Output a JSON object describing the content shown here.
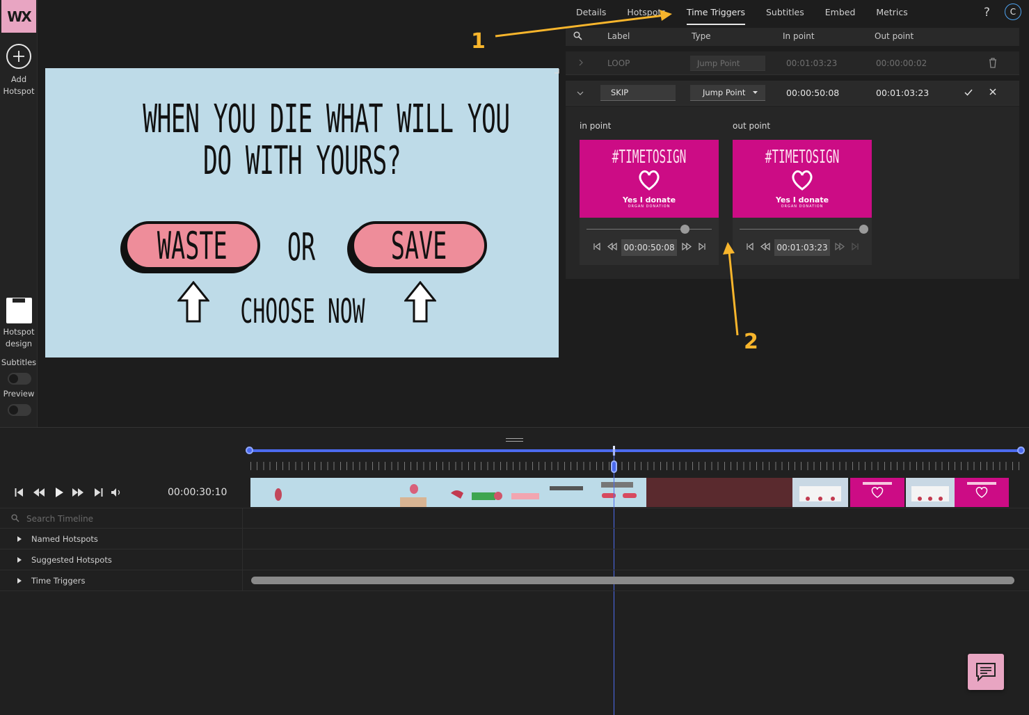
{
  "app": {
    "logo_text": "WX",
    "accent": "#e8a5c2",
    "blue": "#4c6bef",
    "annotation": "#f7b52c"
  },
  "sidebar": {
    "add_label_1": "Add",
    "add_label_2": "Hotspot",
    "design_label_1": "Hotspot",
    "design_label_2": "design",
    "subtitles_label": "Subtitles",
    "preview_label": "Preview"
  },
  "video": {
    "title_line1": "WHEN YOU DIE WHAT WILL YOU",
    "title_line2": "DO WITH YOURS?",
    "left_button": "WASTE",
    "or_text": "OR",
    "right_button": "SAVE",
    "footer": "CHOOSE NOW"
  },
  "tabs": [
    "Details",
    "Hotspots",
    "Time Triggers",
    "Subtitles",
    "Embed",
    "Metrics"
  ],
  "tabs_active": "Time Triggers",
  "header": {
    "help": "?",
    "avatar": "C"
  },
  "triggers": {
    "columns": {
      "label": "Label",
      "type": "Type",
      "in": "In point",
      "out": "Out point"
    },
    "rows": [
      {
        "label": "LOOP",
        "type": "Jump Point",
        "in": "00:01:03:23",
        "out": "00:00:00:02"
      },
      {
        "label": "SKIP",
        "type": "Jump Point",
        "in": "00:00:50:08",
        "out": "00:01:03:23"
      }
    ],
    "detail": {
      "in_label": "in point",
      "out_label": "out point",
      "in_time": "00:00:50:08",
      "out_time": "00:01:03:23",
      "thumb_tag": "#TIMETOSIGN",
      "thumb_yes": "Yes I donate",
      "thumb_org": "ORGAN DONATION"
    }
  },
  "annotations": {
    "one": "1",
    "two": "2"
  },
  "timeline": {
    "timecode": "00:00:30:10",
    "search_placeholder": "Search Timeline",
    "groups": [
      "Named Hotspots",
      "Suggested Hotspots",
      "Time Triggers"
    ]
  }
}
